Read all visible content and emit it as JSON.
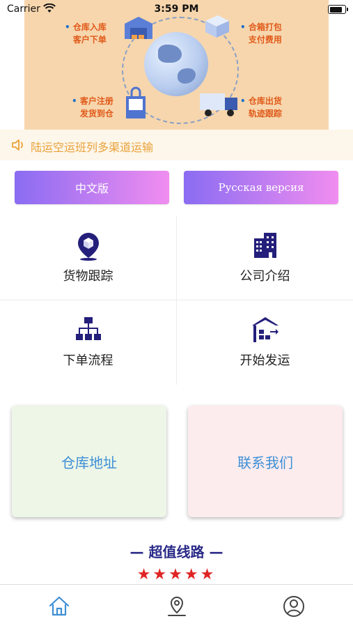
{
  "status_bar": {
    "carrier": "Carrier",
    "time": "3:59 PM"
  },
  "banner": {
    "labels": [
      {
        "line1": "仓库入库",
        "line2": "客户下单"
      },
      {
        "line1": "合箱打包",
        "line2": "支付费用"
      },
      {
        "line1": "客户注册",
        "line2": "发货到仓"
      },
      {
        "line1": "仓库出货",
        "line2": "轨迹跟踪"
      }
    ]
  },
  "notice": {
    "text": "陆运空运班列多渠道运输",
    "icon": "speaker-icon"
  },
  "language_buttons": {
    "chinese": "中文版",
    "russian": "Русская версия"
  },
  "menu": {
    "items": [
      {
        "label": "货物跟踪",
        "icon": "location-box-icon"
      },
      {
        "label": "公司介绍",
        "icon": "building-icon"
      },
      {
        "label": "下单流程",
        "icon": "flowchart-icon"
      },
      {
        "label": "开始发运",
        "icon": "warehouse-shipping-icon"
      }
    ]
  },
  "cards": {
    "warehouse_address": "仓库地址",
    "contact_us": "联系我们"
  },
  "section": {
    "title": "— 超值线路 —",
    "stars": "★★★★★",
    "rating": 5
  },
  "tab_bar": {
    "tabs": [
      "home-icon",
      "location-icon",
      "profile-icon"
    ]
  },
  "colors": {
    "accent": "#2a2a88",
    "link_blue": "#3d8fd6",
    "notice_orange": "#e9a23a",
    "gradient_start": "#8a6cf2",
    "gradient_end": "#f18df0",
    "star_red": "#e02424",
    "tab_active": "#3d8fd6"
  }
}
